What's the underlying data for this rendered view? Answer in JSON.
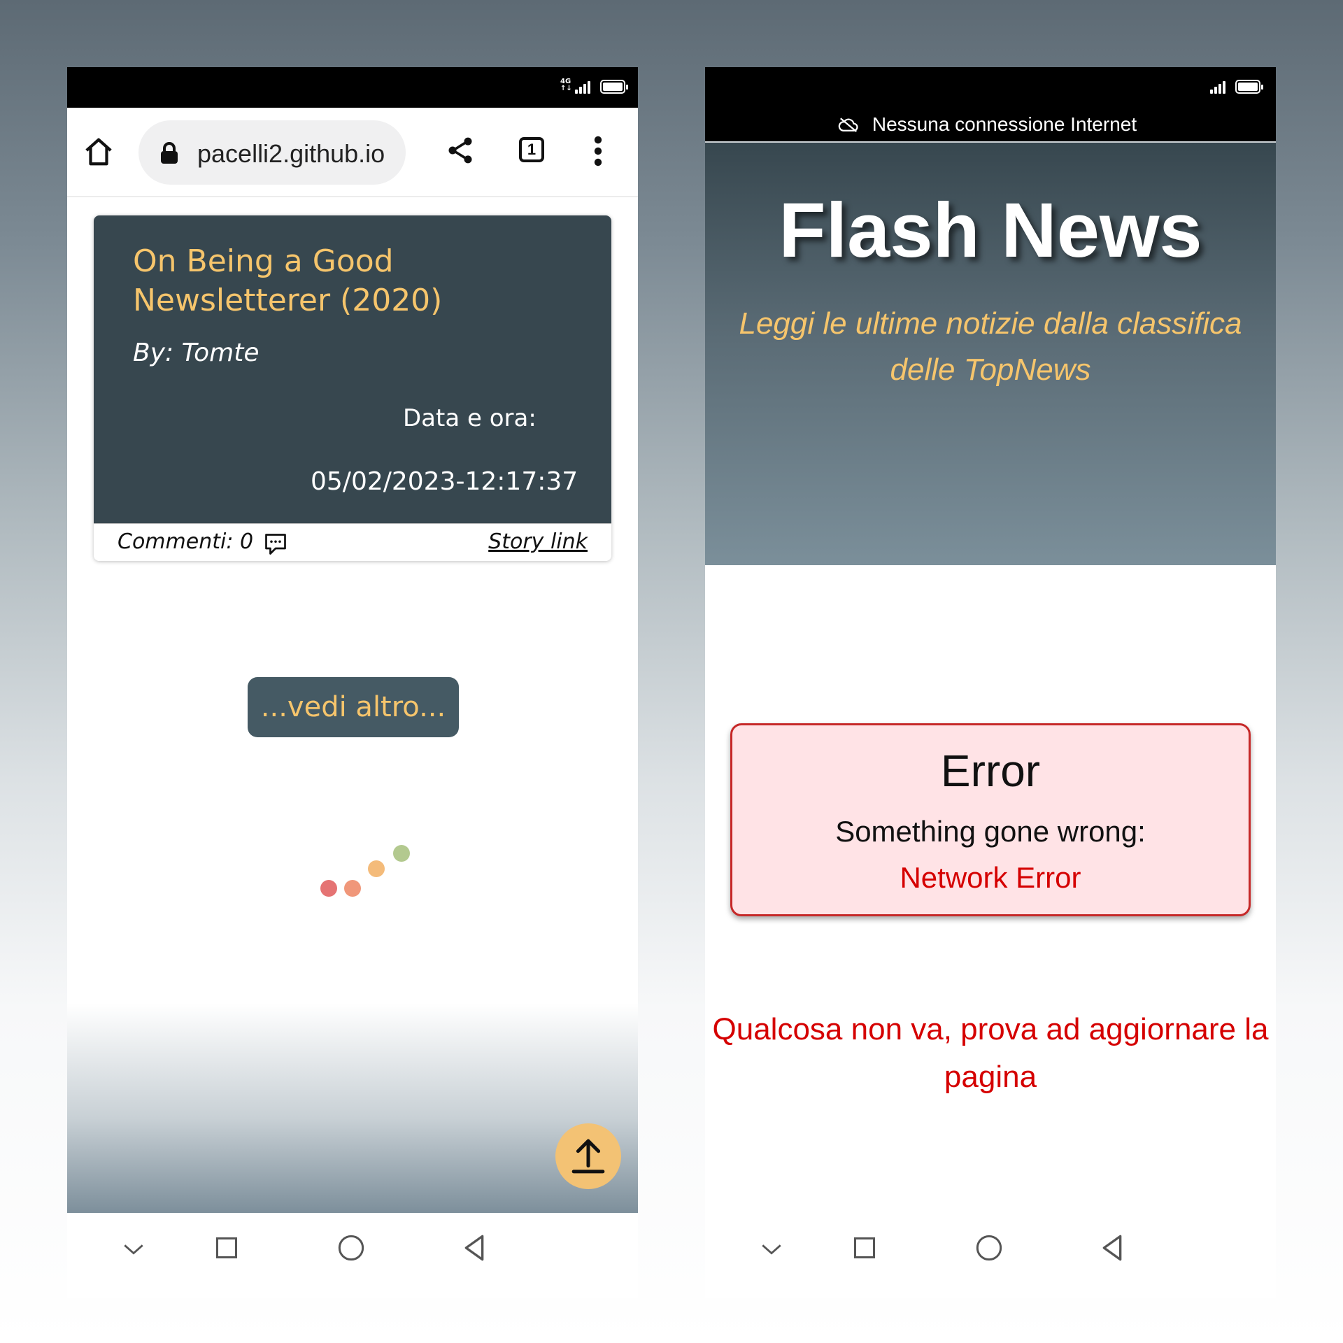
{
  "left_phone": {
    "browser": {
      "url": "pacelli2.github.io",
      "tab_count": "1"
    },
    "story": {
      "title": "On Being a Good Newsletterer (2020)",
      "author": "By: Tomte",
      "date_label": "Data e ora:",
      "date_value": "05/02/2023-12:17:37",
      "comments": "Commenti: 0",
      "story_link": "Story link"
    },
    "load_more": "...vedi altro...",
    "loader_colors": [
      "#e57373",
      "#f0977a",
      "#f4bb7a",
      "#b3c98f"
    ]
  },
  "right_phone": {
    "status": "Nessuna connessione Internet",
    "header": {
      "title": "Flash News",
      "subtitle": "Leggi le ultime notizie dalla classifica delle TopNews"
    },
    "error": {
      "title": "Error",
      "message": "Something gone wrong:",
      "detail": "Network Error"
    },
    "retry_text": "Qualcosa non va, prova ad aggiornare la pagina"
  },
  "colors": {
    "accent_yellow": "#f6c56c",
    "dark_slate": "#37474f",
    "error_red": "#d50000",
    "error_bg": "#ffe3e6"
  },
  "icons": [
    "home-icon",
    "lock-icon",
    "share-icon",
    "tabs-icon",
    "more-vert-icon",
    "comment-icon",
    "arrow-up-icon",
    "cloud-off-icon",
    "signal-icon",
    "battery-icon",
    "nav-down-icon",
    "nav-square-icon",
    "nav-circle-icon",
    "nav-back-icon"
  ]
}
